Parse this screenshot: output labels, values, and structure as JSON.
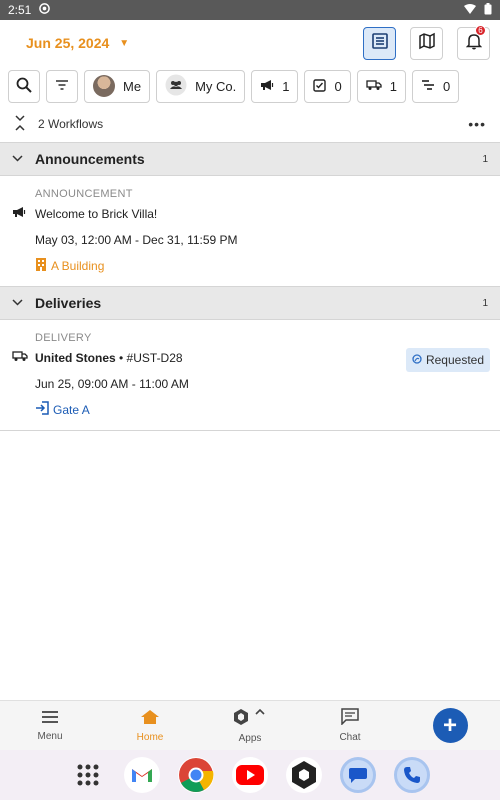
{
  "status_bar": {
    "time": "2:51"
  },
  "header": {
    "date": "Jun 25, 2024"
  },
  "notifications": {
    "count": "6"
  },
  "filters": {
    "me_label": "Me",
    "company_label": "My Co.",
    "announcements_count": "1",
    "tasks_count": "0",
    "deliveries_count": "1",
    "gantt_count": "0"
  },
  "workflows": {
    "label": "2 Workflows"
  },
  "sections": [
    {
      "title": "Announcements",
      "count": "1",
      "item": {
        "type": "ANNOUNCEMENT",
        "title": "Welcome to Brick Villa!",
        "time": "May 03, 12:00 AM - Dec 31, 11:59 PM",
        "location": "A Building"
      }
    },
    {
      "title": "Deliveries",
      "count": "1",
      "item": {
        "type": "DELIVERY",
        "company": "United Stones",
        "code": "• #UST-D28",
        "time": "Jun 25, 09:00 AM - 11:00 AM",
        "location": "Gate A",
        "status": "Requested"
      }
    }
  ],
  "bottom_nav": {
    "menu": "Menu",
    "home": "Home",
    "apps": "Apps",
    "chat": "Chat"
  },
  "colors": {
    "accent": "#e8901e",
    "primary": "#1c5cb5"
  }
}
